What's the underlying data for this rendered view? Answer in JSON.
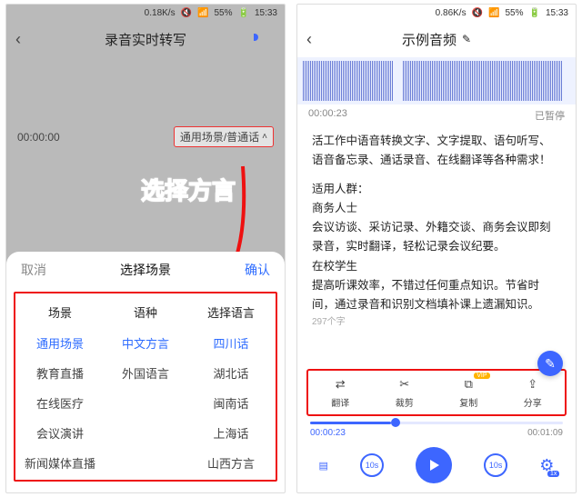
{
  "left": {
    "status": {
      "net": "0.18K/s",
      "signal": "55%",
      "time": "15:33"
    },
    "nav": {
      "title": "录音实时转写"
    },
    "timer": "00:00:00",
    "scene_btn": "通用场景/普通话",
    "callout": "选择方言",
    "sheet": {
      "cancel": "取消",
      "title": "选择场景",
      "ok": "确认",
      "headers": [
        "场景",
        "语种",
        "选择语言"
      ],
      "col_scene": [
        "通用场景",
        "教育直播",
        "在线医疗",
        "会议演讲",
        "新闻媒体直播"
      ],
      "col_lang": [
        "中文方言",
        "外国语言",
        "",
        ""
      ],
      "col_dialect": [
        "四川话",
        "湖北话",
        "闽南话",
        "上海话",
        "山西方言"
      ]
    }
  },
  "right": {
    "status": {
      "net": "0.86K/s",
      "signal": "55%",
      "time": "15:33"
    },
    "nav": {
      "title": "示例音频"
    },
    "elapsed": "00:00:23",
    "state": "已暂停",
    "transcript": {
      "p1": "活工作中语音转换文字、文字提取、语句听写、语音备忘录、通话录音、在线翻译等各种需求！",
      "p2": "适用人群：",
      "p3": "商务人士",
      "p4": "会议访谈、采访记录、外籍交谈、商务会议即刻录音，实时翻译，轻松记录会议纪要。",
      "p5": "在校学生",
      "p6": "提高听课效率，不错过任何重点知识。节省时间，通过录音和识别文档填补课上遗漏知识。",
      "count": "297个字"
    },
    "actions": {
      "translate": "翻译",
      "crop": "裁剪",
      "copy": "复制",
      "share": "分享",
      "vip": "VIP"
    },
    "progress": {
      "cur": "00:00:23",
      "end": "00:01:09"
    },
    "controls": {
      "skip": "10s",
      "speed": "1x"
    }
  }
}
